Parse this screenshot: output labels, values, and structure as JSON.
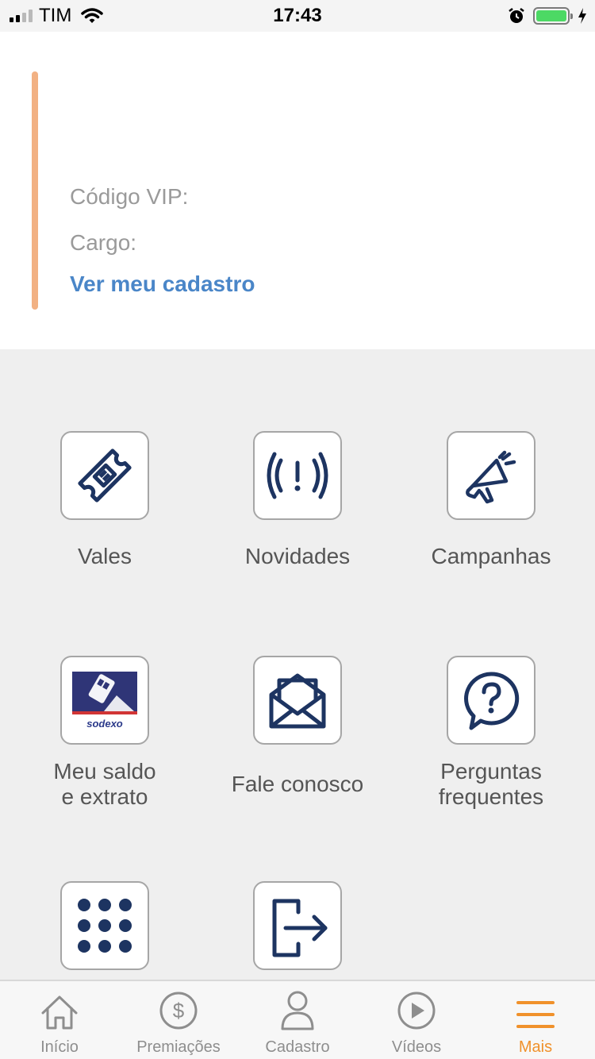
{
  "status_bar": {
    "carrier": "TIM",
    "time": "17:43",
    "battery_level": 1.0
  },
  "profile": {
    "vip_label": "Código VIP:",
    "cargo_label": "Cargo:",
    "link_label": "Ver meu cadastro",
    "accent_color": "#f2b183",
    "link_color": "#4a86c8"
  },
  "menu": {
    "items": [
      {
        "label": "Vales",
        "icon": "ticket-icon"
      },
      {
        "label": "Novidades",
        "icon": "alert-icon"
      },
      {
        "label": "Campanhas",
        "icon": "megaphone-icon"
      },
      {
        "label": "Meu saldo\ne extrato",
        "icon": "sodexo-logo",
        "logo_text": "sodexo"
      },
      {
        "label": "Fale conosco",
        "icon": "envelope-icon"
      },
      {
        "label": "Perguntas\nfrequentes",
        "icon": "question-icon"
      },
      {
        "label": "",
        "icon": "apps-grid-icon"
      },
      {
        "label": "",
        "icon": "logout-icon"
      }
    ],
    "icon_color": "#1d3461"
  },
  "tab_bar": {
    "tabs": [
      {
        "label": "Início",
        "icon": "home-icon"
      },
      {
        "label": "Premiações",
        "icon": "dollar-icon"
      },
      {
        "label": "Cadastro",
        "icon": "user-icon"
      },
      {
        "label": "Vídeos",
        "icon": "play-icon"
      },
      {
        "label": "Mais",
        "icon": "menu-icon",
        "active": true
      }
    ],
    "active_color": "#f0912b"
  }
}
